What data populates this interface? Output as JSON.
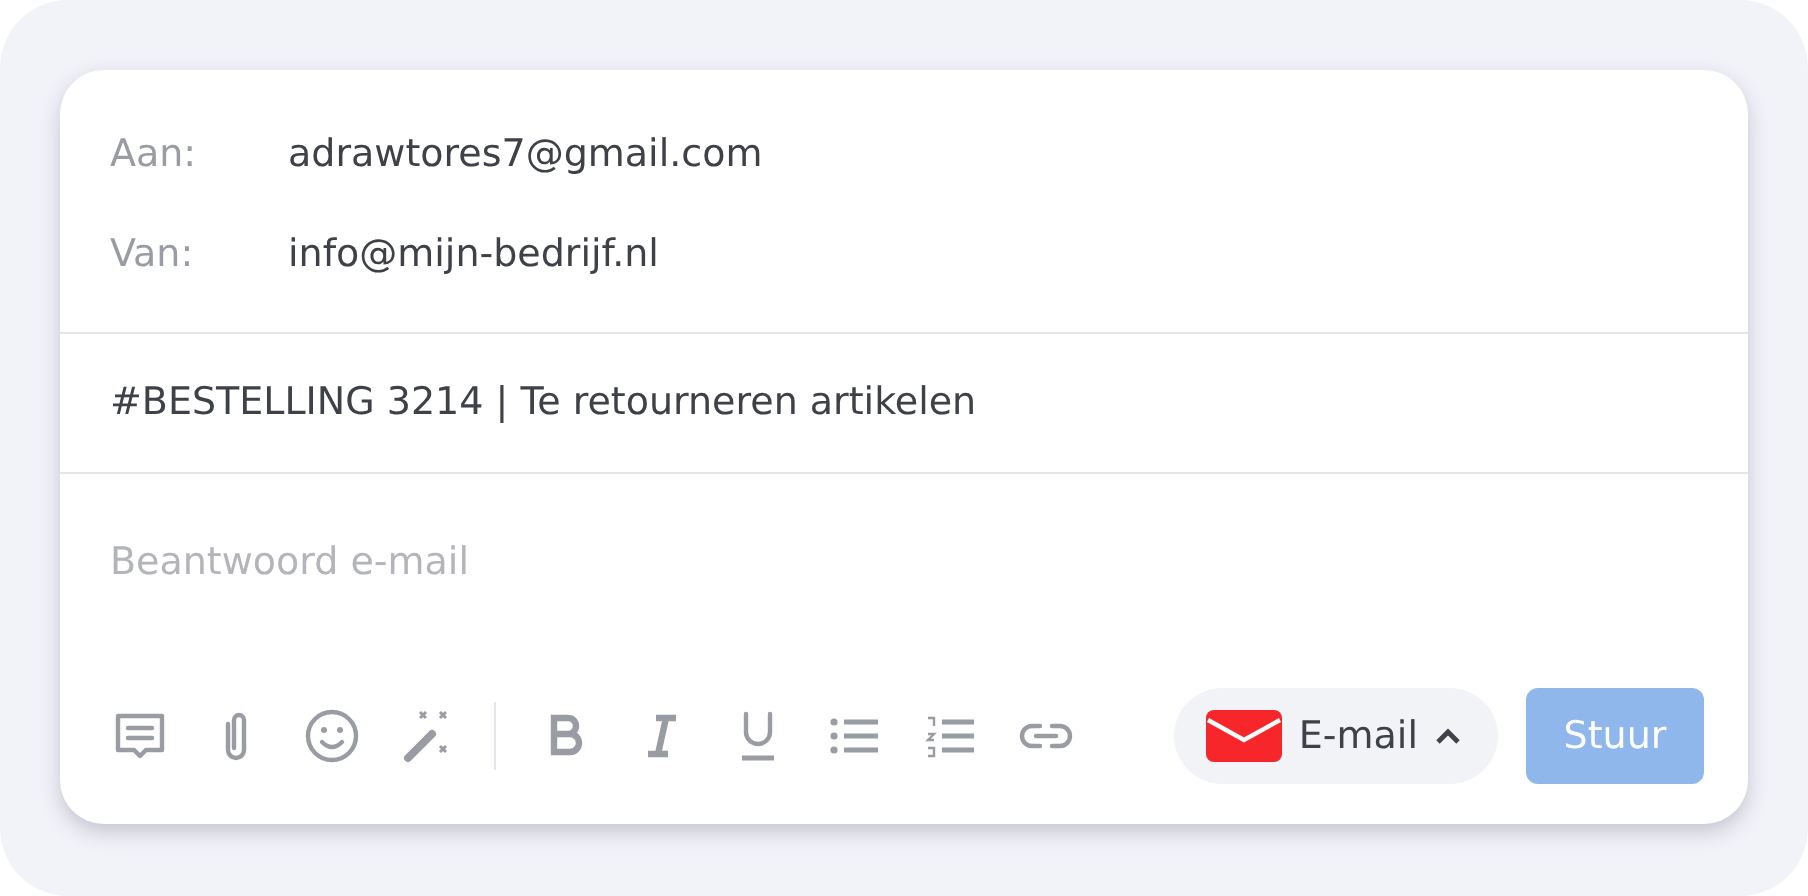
{
  "recipients": [
    {
      "label": "Aan:",
      "value": "adrawtores7@gmail.com"
    },
    {
      "label": "Van:",
      "value": "info@mijn-bedrijf.nl"
    }
  ],
  "subject": "#BESTELLING 3214 | Te retourneren artikelen",
  "reply": {
    "placeholder": "Beantwoord e-mail"
  },
  "channel": {
    "label": "E-mail",
    "expanded": false
  },
  "send": {
    "label": "Stuur",
    "disabled": true
  }
}
